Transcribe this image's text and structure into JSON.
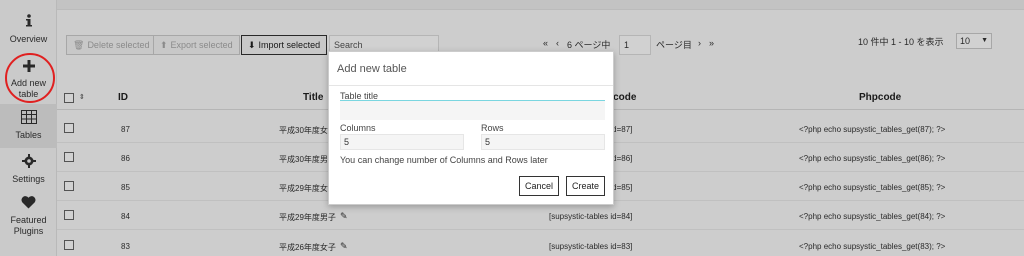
{
  "sidebar": {
    "items": [
      {
        "label": "Overview",
        "icon": "info-icon"
      },
      {
        "label": "Add new table",
        "icon": "plus-icon"
      },
      {
        "label": "Tables",
        "icon": "table-icon"
      },
      {
        "label": "Settings",
        "icon": "gear-icon"
      },
      {
        "label": "Featured Plugins",
        "icon": "heart-icon"
      }
    ]
  },
  "toolbar": {
    "delete_label": "Delete selected",
    "export_label": "Export selected",
    "import_label": "Import selected",
    "search_placeholder": "Search"
  },
  "pagination": {
    "page_count_text": "6 ページ中",
    "current_page": "1",
    "page_suffix": "ページ目",
    "record_count": "10 件中 1 - 10 を表示",
    "per_page": "10"
  },
  "table": {
    "headers": {
      "id": "ID",
      "title": "Title",
      "shortcode": "Shortcode",
      "phpcode": "Phpcode"
    },
    "rows": [
      {
        "id": "87",
        "title": "平成30年度女子",
        "shortcode": "[supsystic-tables id=87]",
        "phpcode": "<?php echo supsystic_tables_get(87); ?>"
      },
      {
        "id": "86",
        "title": "平成30年度男子",
        "shortcode": "[supsystic-tables id=86]",
        "phpcode": "<?php echo supsystic_tables_get(86); ?>"
      },
      {
        "id": "85",
        "title": "平成29年度女子",
        "shortcode": "[supsystic-tables id=85]",
        "phpcode": "<?php echo supsystic_tables_get(85); ?>"
      },
      {
        "id": "84",
        "title": "平成29年度男子",
        "shortcode": "[supsystic-tables id=84]",
        "phpcode": "<?php echo supsystic_tables_get(84); ?>"
      },
      {
        "id": "83",
        "title": "平成26年度女子",
        "shortcode": "[supsystic-tables id=83]",
        "phpcode": "<?php echo supsystic_tables_get(83); ?>"
      }
    ]
  },
  "modal": {
    "title": "Add new table",
    "table_title_label": "Table title",
    "table_title_value": "",
    "columns_label": "Columns",
    "columns_value": "5",
    "rows_label": "Rows",
    "rows_value": "5",
    "hint": "You can change number of Columns and Rows later",
    "cancel_label": "Cancel",
    "create_label": "Create"
  },
  "colors": {
    "annotation_circle": "#e02020",
    "input_focus": "#7ad6e0"
  }
}
